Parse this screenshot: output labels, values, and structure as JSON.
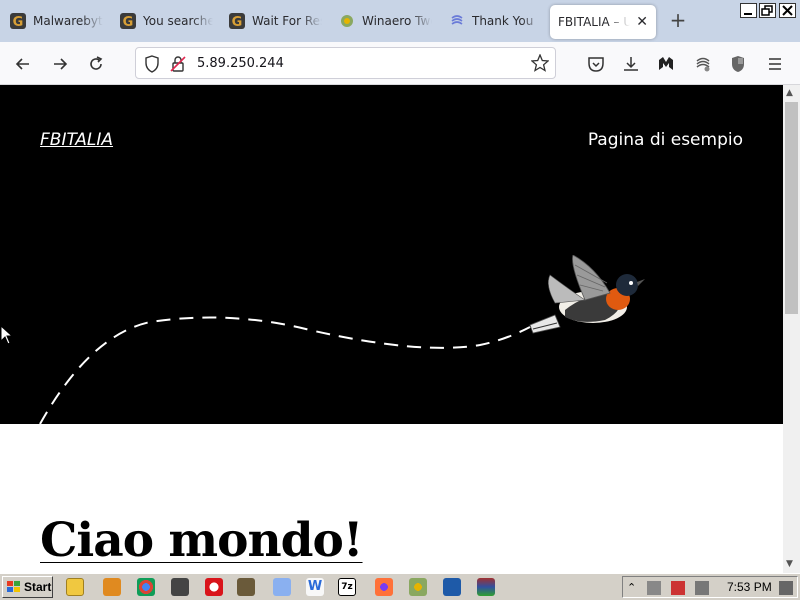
{
  "browser": {
    "tabs": [
      {
        "title": "Malwarebytes",
        "icon": "g-icon"
      },
      {
        "title": "You searched",
        "icon": "g-icon"
      },
      {
        "title": "Wait For Res",
        "icon": "g-icon"
      },
      {
        "title": "Winaero Twe",
        "icon": "winaero-icon"
      },
      {
        "title": "Thank You",
        "icon": "swirl-icon"
      },
      {
        "title": "FBITALIA – Un",
        "icon": "none",
        "active": true
      }
    ],
    "new_tab": "+",
    "url": "5.89.250.244"
  },
  "page": {
    "site_title": "FBITALIA",
    "menu_link": "Pagina di esempio",
    "post_title": "Ciao mondo!",
    "hero_color": "#000000"
  },
  "taskbar": {
    "start_label": "Start",
    "clock": "7:53 PM"
  },
  "colors": {
    "tabstrip": "#c8d4e6",
    "accent_g": "#c8821a",
    "firefox": "#ff7139"
  }
}
